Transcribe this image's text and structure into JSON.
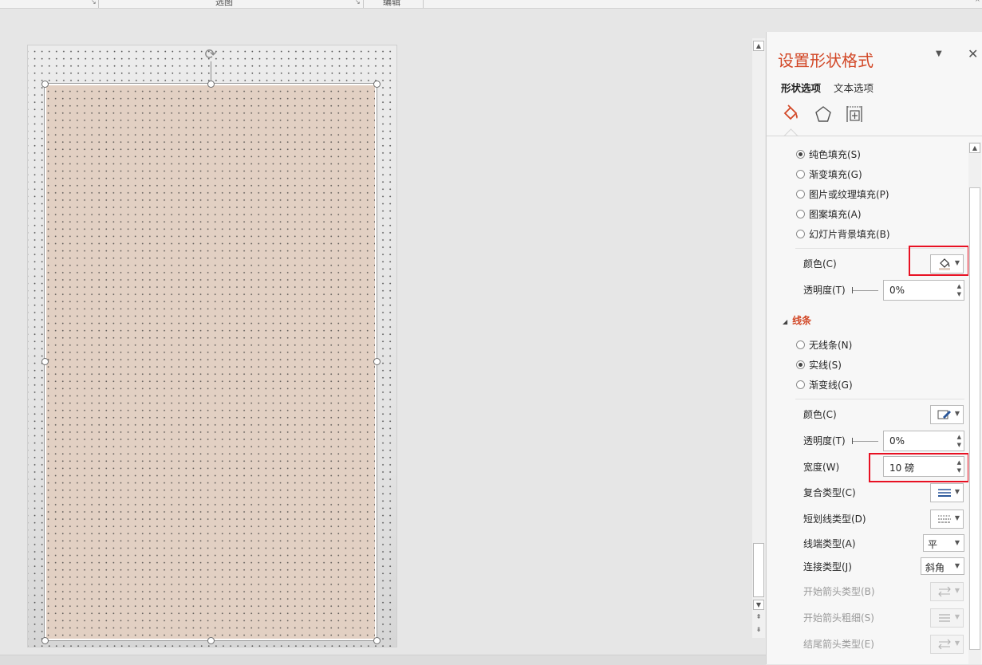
{
  "ribbon": {
    "group_labels": [
      "选图",
      "编辑"
    ]
  },
  "pane": {
    "title": "设置形状格式",
    "tabs": [
      "形状选项",
      "文本选项"
    ],
    "category_icons": [
      "fill-line-icon",
      "effects-pentagon-icon",
      "size-properties-icon"
    ],
    "fill_options": [
      {
        "label": "纯色填充(S)",
        "checked": true
      },
      {
        "label": "渐变填充(G)",
        "checked": false
      },
      {
        "label": "图片或纹理填充(P)",
        "checked": false
      },
      {
        "label": "图案填充(A)",
        "checked": false
      },
      {
        "label": "幻灯片背景填充(B)",
        "checked": false
      }
    ],
    "fill_color_label": "颜色(C)",
    "fill_transparency_label": "透明度(T)",
    "fill_transparency_value": "0%",
    "lines_section_title": "线条",
    "line_options": [
      {
        "label": "无线条(N)",
        "checked": false
      },
      {
        "label": "实线(S)",
        "checked": true
      },
      {
        "label": "渐变线(G)",
        "checked": false
      }
    ],
    "line_color_label": "颜色(C)",
    "line_transparency_label": "透明度(T)",
    "line_transparency_value": "0%",
    "width_label": "宽度(W)",
    "width_value": "10 磅",
    "compound_label": "复合类型(C)",
    "dash_label": "短划线类型(D)",
    "cap_label": "线端类型(A)",
    "cap_value": "平",
    "join_label": "连接类型(J)",
    "join_value": "斜角",
    "begin_arrow_type_label": "开始箭头类型(B)",
    "begin_arrow_size_label": "开始箭头粗细(S)",
    "end_arrow_type_label": "结尾箭头类型(E)"
  },
  "colors": {
    "accent": "#d24726",
    "shape_fill": "#e2d0c3",
    "highlight": "#e81123"
  }
}
